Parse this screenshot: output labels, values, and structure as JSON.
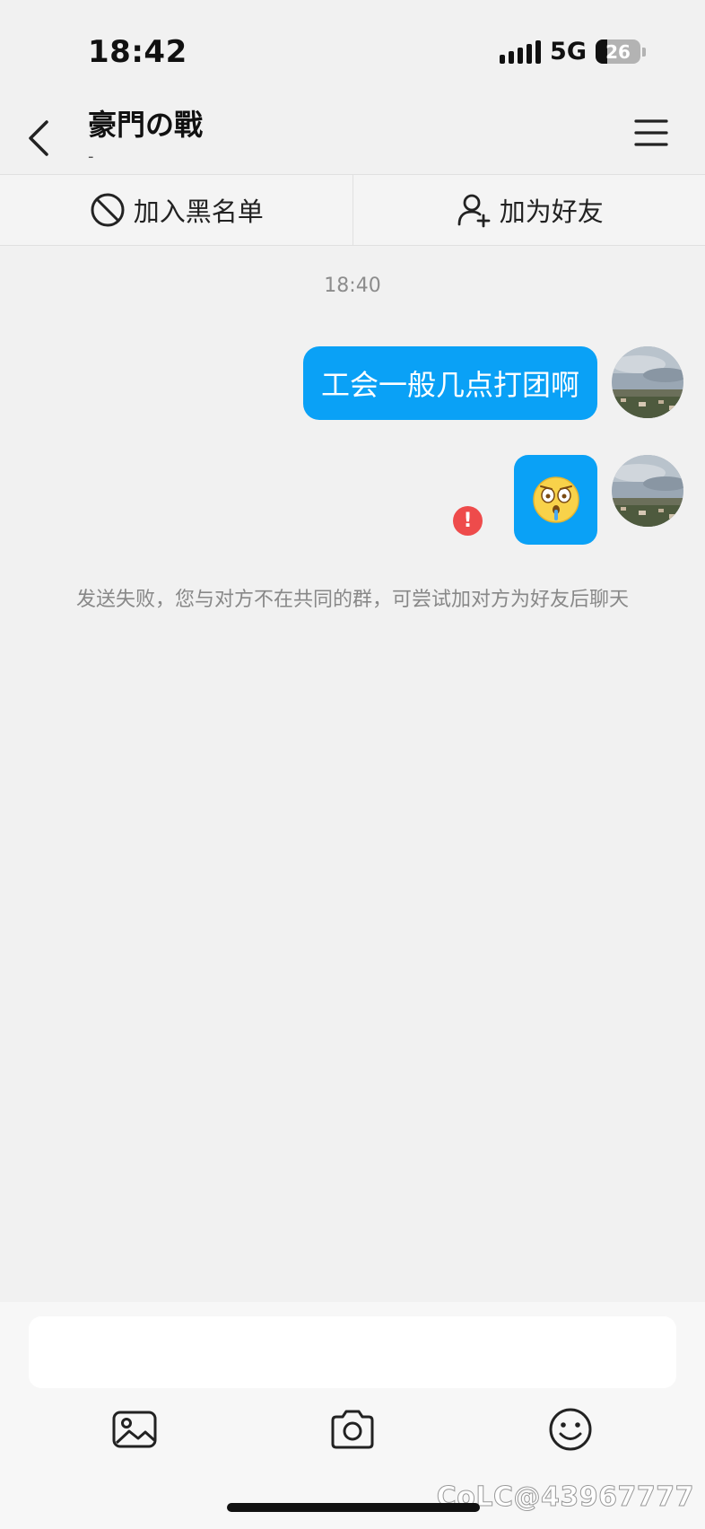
{
  "status_bar": {
    "time": "18:42",
    "network": "5G",
    "battery": "26",
    "battery_level": 0.26
  },
  "header": {
    "title": "豪門の戰",
    "subtitle": "-"
  },
  "actions": {
    "block_label": "加入黑名单",
    "add_friend_label": "加为好友"
  },
  "chat": {
    "timestamp": "18:40",
    "messages": [
      {
        "type": "text",
        "text": "工会一般几点打团啊",
        "from": "self"
      },
      {
        "type": "sticker",
        "icon": "shocked-face-emoji",
        "from": "self",
        "status": "failed"
      }
    ],
    "error_mark": "!",
    "failure_notice": "发送失败，您与对方不在共同的群，可尝试加对方为好友后聊天"
  },
  "input": {
    "value": "",
    "placeholder": ""
  },
  "toolbar": {
    "icons": [
      "image-icon",
      "camera-icon",
      "emoji-icon"
    ]
  },
  "watermark": "CoLC@43967777",
  "colors": {
    "bubble": "#0aa1f6",
    "background": "#f1f1f1",
    "error": "#ee4b4b"
  }
}
